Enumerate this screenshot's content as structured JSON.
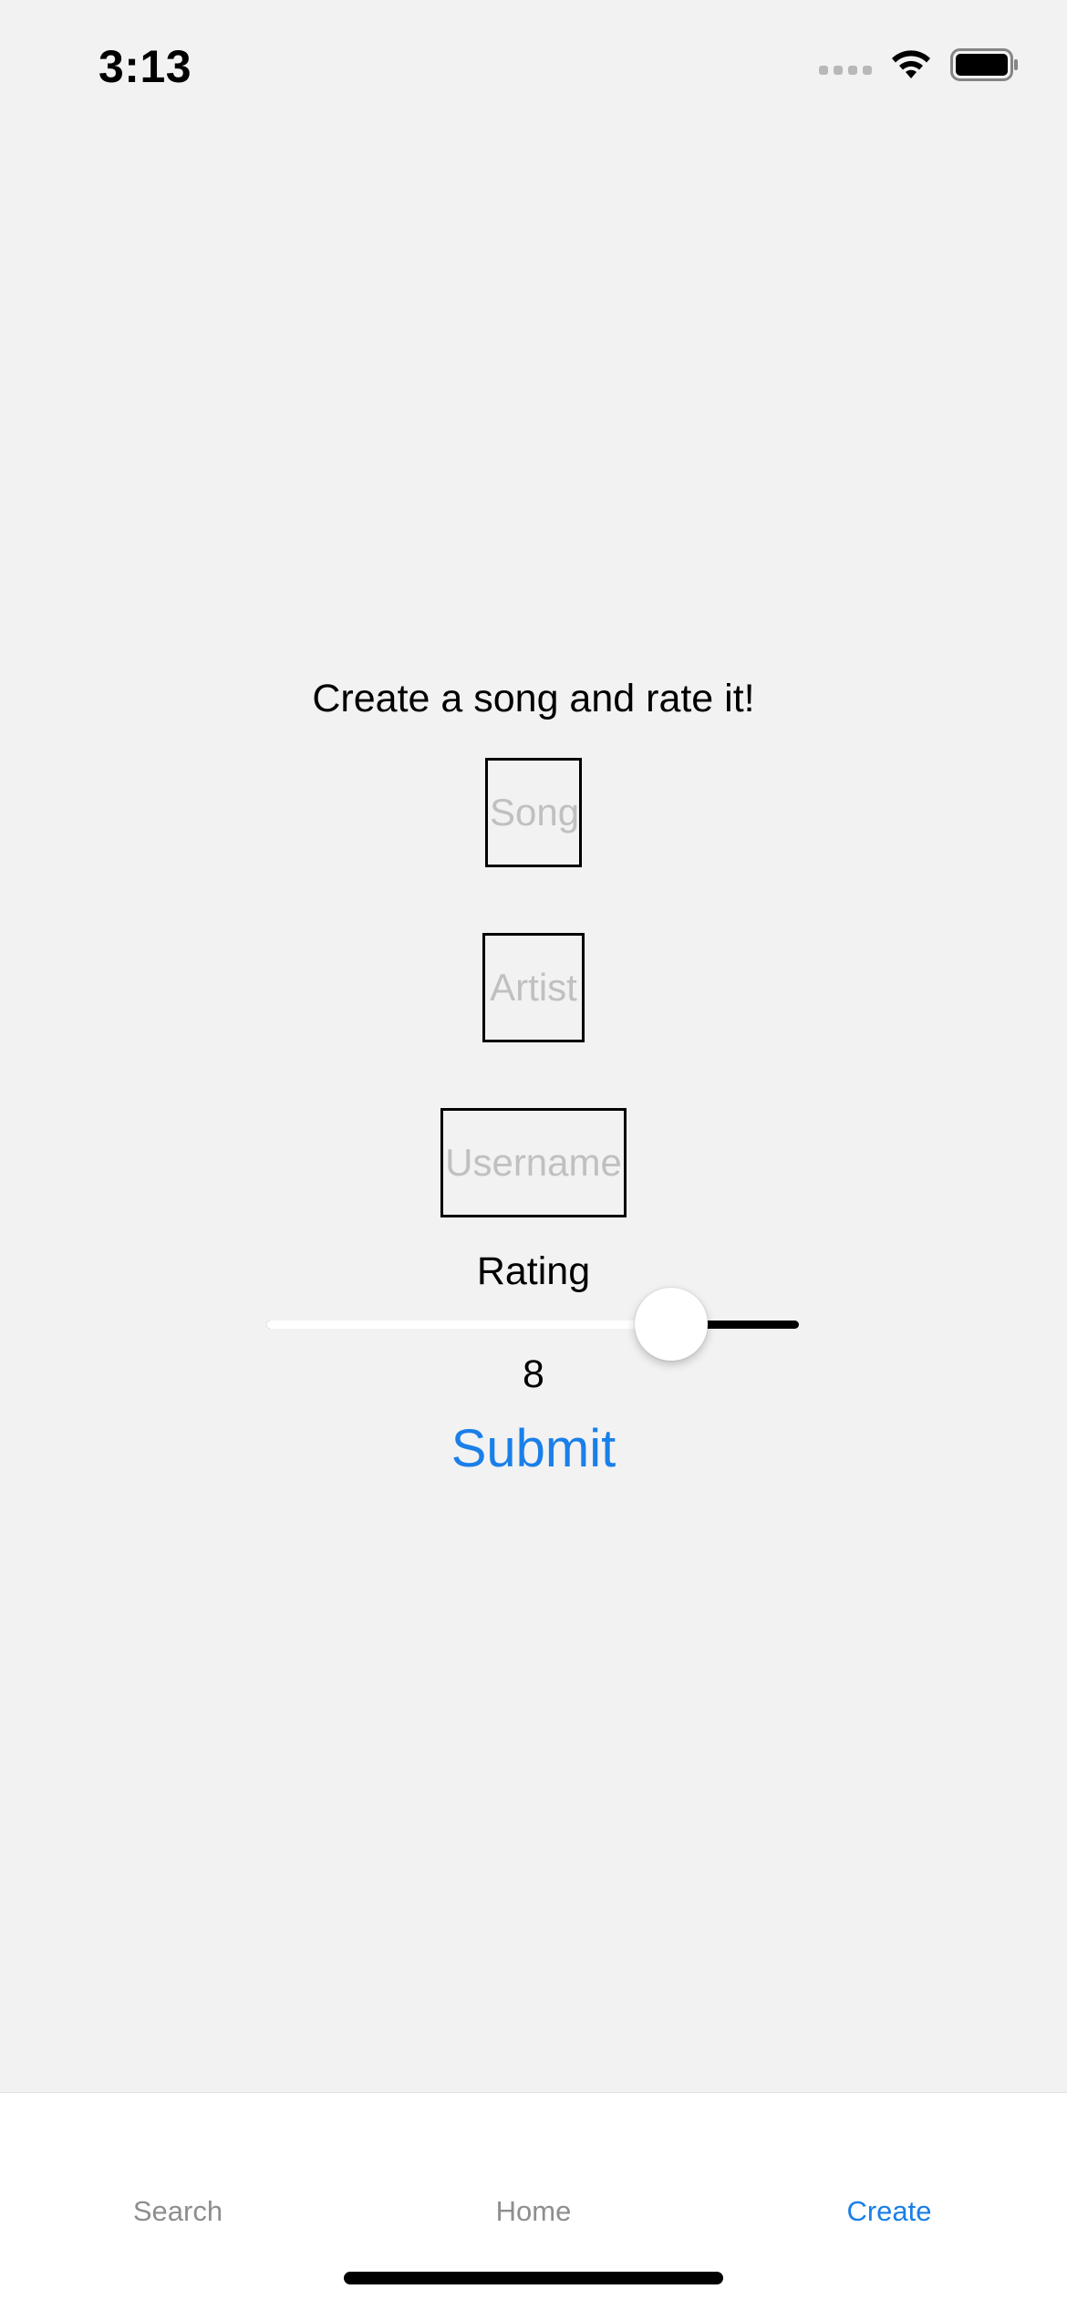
{
  "status_bar": {
    "time": "3:13",
    "icons": [
      "signal-icon",
      "wifi-icon",
      "battery-icon"
    ]
  },
  "form": {
    "title": "Create a song and rate it!",
    "song_placeholder": "Song",
    "artist_placeholder": "Artist",
    "username_placeholder": "Username",
    "rating_label": "Rating",
    "rating_value": "8",
    "slider_fraction": 0.76,
    "submit_label": "Submit"
  },
  "tabs": [
    {
      "label": "Search",
      "active": false
    },
    {
      "label": "Home",
      "active": false
    },
    {
      "label": "Create",
      "active": true
    }
  ],
  "colors": {
    "accent": "#1a7fe8",
    "background": "#f2f2f2",
    "inactive_tab": "#8e8e8e",
    "placeholder": "#c0c0c0"
  }
}
